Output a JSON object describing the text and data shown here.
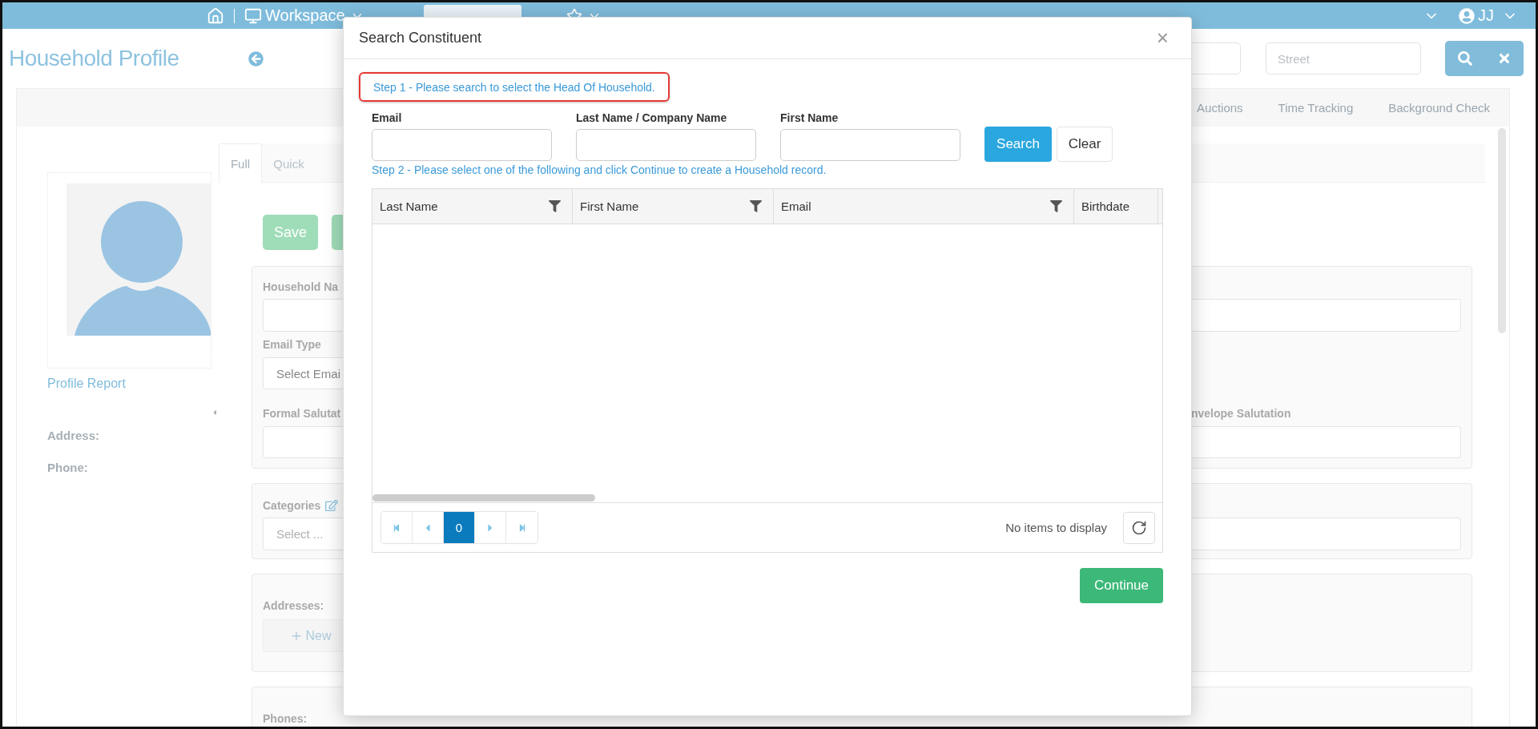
{
  "top_bar": {
    "workspace_label": "Workspace",
    "user_initials": "JJ"
  },
  "header": {
    "title": "Household Profile",
    "street_field": {
      "placeholder": "Street"
    }
  },
  "module_tabs": [
    {
      "label": "Auctions"
    },
    {
      "label": "Time Tracking"
    },
    {
      "label": "Background Check"
    }
  ],
  "profile": {
    "report_link": "Profile Report",
    "fields": [
      {
        "label": "Address:"
      },
      {
        "label": "Phone:"
      }
    ]
  },
  "form_tabs": [
    {
      "label": "Full",
      "selected": true
    },
    {
      "label": "Quick",
      "selected": false
    }
  ],
  "save_button": "Save",
  "form": {
    "household_name_label": "Household Na",
    "email_type_label": "Email Type",
    "email_type_placeholder": "Select Emai",
    "formal_salutation_label": "Formal Salutat",
    "envelope_salutation_label": "nvelope Salutation",
    "categories_label": "Categories",
    "categories_placeholder": "Select ...",
    "addresses_label": "Addresses:",
    "new_button": "New",
    "phones_label": "Phones:"
  },
  "modal": {
    "title": "Search Constituent",
    "close": "×",
    "step1": {
      "text": "Step 1 - Please search to select the Head Of Household.",
      "highlighted": true
    },
    "fields": [
      {
        "label": "Email"
      },
      {
        "label": "Last Name / Company Name"
      },
      {
        "label": "First Name"
      }
    ],
    "search_button": "Search",
    "clear_button": "Clear",
    "step2": "Step 2 - Please select one of the following and click Continue to create a Household record.",
    "grid": {
      "columns": [
        {
          "label": "Last Name",
          "filterable": true
        },
        {
          "label": "First Name",
          "filterable": true
        },
        {
          "label": "Email",
          "filterable": true
        },
        {
          "label": "Birthdate",
          "filterable": false
        }
      ]
    },
    "pager": {
      "pages": [
        {
          "label": "0",
          "selected": true
        }
      ],
      "status": "No items to display"
    },
    "continue_button": "Continue"
  }
}
